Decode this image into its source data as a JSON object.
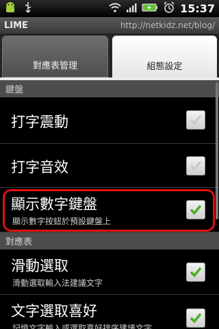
{
  "status_bar": {
    "time": "15:37",
    "icons": [
      "android-icon",
      "usb-icon",
      "wifi-icon",
      "signal-icon",
      "battery-icon",
      "alarm-icon"
    ]
  },
  "title_bar": {
    "app_name": "LIME",
    "url": "http://netkidz.net/blog/"
  },
  "tabs": [
    {
      "label": "對應表管理",
      "active": false
    },
    {
      "label": "組態設定",
      "active": true
    }
  ],
  "sections": [
    {
      "header": "鍵盤",
      "items": [
        {
          "title": "打字震動",
          "summary": "",
          "checked": false
        },
        {
          "title": "打字音效",
          "summary": "",
          "checked": false
        },
        {
          "title": "顯示數字鍵盤",
          "summary": "顯示數字按鈕於預設鍵盤上",
          "checked": true
        }
      ]
    },
    {
      "header": "對應表",
      "items": [
        {
          "title": "滑動選取",
          "summary": "滑動選取輸入法建議文字",
          "checked": true
        },
        {
          "title": "文字選取喜好",
          "summary": "記憶文字輸入或選取喜好排序建議文字",
          "checked": true
        }
      ]
    }
  ],
  "colors": {
    "check_green": "#4caf21",
    "highlight_red": "#e01010"
  }
}
